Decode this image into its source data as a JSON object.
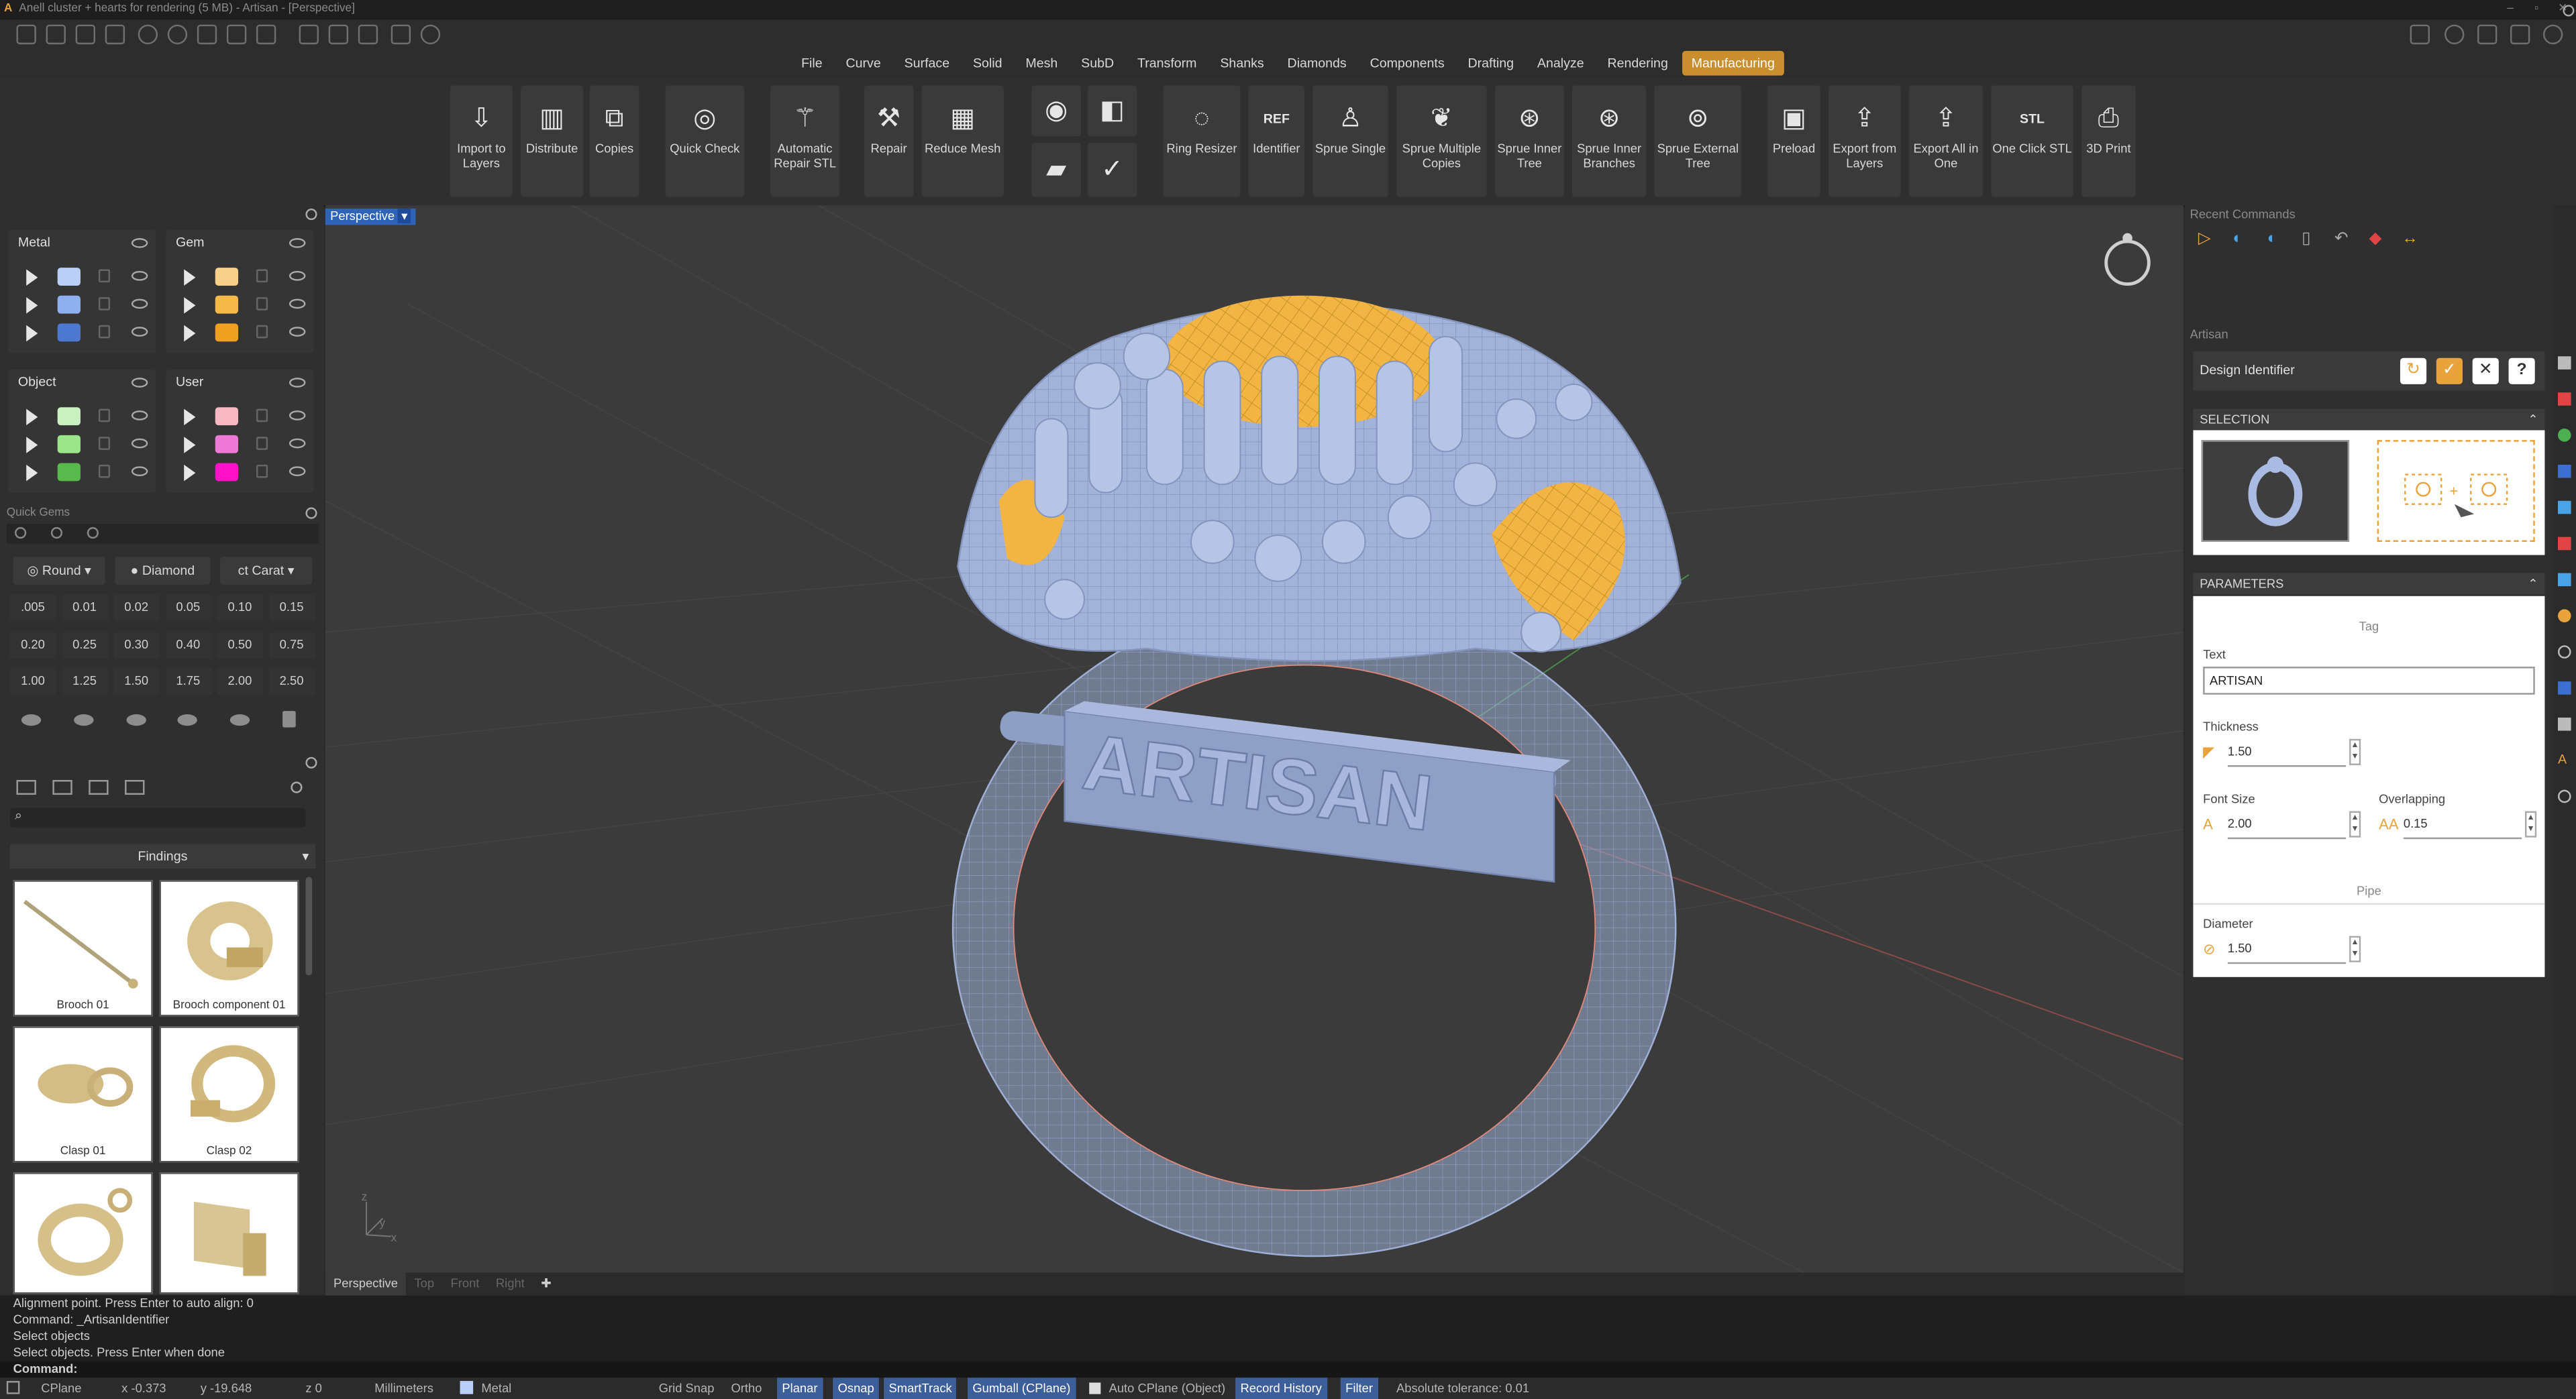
{
  "window": {
    "title": "Anell cluster + hearts for rendering (5 MB) - Artisan - [Perspective]"
  },
  "menu": [
    "File",
    "Curve",
    "Surface",
    "Solid",
    "Mesh",
    "SubD",
    "Transform",
    "Shanks",
    "Diamonds",
    "Components",
    "Drafting",
    "Analyze",
    "Rendering",
    "Manufacturing"
  ],
  "active_menu": "Manufacturing",
  "ribbon": {
    "tools": [
      {
        "label": "Import to Layers",
        "icon": "import-icon"
      },
      {
        "label": "Distribute",
        "icon": "distribute-icon"
      },
      {
        "label": "Copies",
        "icon": "copies-icon"
      },
      {
        "label": "Quick Check",
        "icon": "quick-check-icon"
      },
      {
        "label": "Automatic Repair STL",
        "icon": "magic-wand-icon"
      },
      {
        "label": "Repair",
        "icon": "wrench-icon"
      },
      {
        "label": "Reduce Mesh",
        "icon": "mesh-icon"
      },
      {
        "label": "Ring Resizer",
        "icon": "ring-resizer-icon"
      },
      {
        "label": "Identifier",
        "icon": "ref-icon",
        "badge": "REF"
      },
      {
        "label": "Sprue Single",
        "icon": "sprue-icon"
      },
      {
        "label": "Sprue Multiple Copies",
        "icon": "sprue-tree-icon"
      },
      {
        "label": "Sprue Inner Tree",
        "icon": "sprue-inner-icon"
      },
      {
        "label": "Sprue Inner Branches",
        "icon": "sprue-branches-icon"
      },
      {
        "label": "Sprue External Tree",
        "icon": "sprue-external-icon"
      },
      {
        "label": "Preload",
        "icon": "preload-icon"
      },
      {
        "label": "Export from Layers",
        "icon": "export-layers-icon"
      },
      {
        "label": "Export All in One",
        "icon": "export-all-icon"
      },
      {
        "label": "One Click STL",
        "icon": "stl-icon",
        "badge": "STL"
      },
      {
        "label": "3D Print",
        "icon": "printer-icon"
      }
    ]
  },
  "layers": {
    "groups": [
      {
        "name": "Metal",
        "colors": [
          "#b9cff5",
          "#8fb0ee",
          "#4d78cf"
        ]
      },
      {
        "name": "Gem",
        "colors": [
          "#f8d08a",
          "#f5b849",
          "#f0a020"
        ]
      },
      {
        "name": "Object",
        "colors": [
          "#c9f0c0",
          "#9be68a",
          "#58b94c"
        ]
      },
      {
        "name": "User",
        "colors": [
          "#f7b8c3",
          "#ee78d6",
          "#ff12c8"
        ]
      }
    ]
  },
  "quick_gems": {
    "title": "Quick Gems",
    "shape": "Round",
    "material": "Diamond",
    "unit": "Carat",
    "values": [
      ".005",
      "0.01",
      "0.02",
      "0.05",
      "0.10",
      "0.15",
      "0.20",
      "0.25",
      "0.30",
      "0.40",
      "0.50",
      "0.75",
      "1.00",
      "1.25",
      "1.50",
      "1.75",
      "2.00",
      "2.50"
    ]
  },
  "library": {
    "category": "Findings",
    "items": [
      "Brooch 01",
      "Brooch component 01",
      "Clasp 01",
      "Clasp 02"
    ]
  },
  "viewport": {
    "active": "Perspective",
    "tabs": [
      "Perspective",
      "Top",
      "Front",
      "Right"
    ],
    "engraving": "ARTISAN",
    "axis_labels": [
      "z",
      "y",
      "x"
    ]
  },
  "command_history": [
    "Alignment point. Press Enter to auto align: 0",
    "Command: _ArtisanIdentifier",
    "Select objects",
    "Select objects. Press Enter when done"
  ],
  "command_prompt": "Command:",
  "status": {
    "cplane": "CPlane",
    "x": "x -0.373",
    "y": "y -19.648",
    "z": "z 0",
    "units": "Millimeters",
    "layer": "Metal",
    "grid_snap": "Grid Snap",
    "ortho": "Ortho",
    "planar": "Planar",
    "osnap": "Osnap",
    "smarttrack": "SmartTrack",
    "gumball": "Gumball (CPlane)",
    "auto_cplane": "Auto CPlane (Object)",
    "record_history": "Record History",
    "filter": "Filter",
    "tolerance": "Absolute tolerance: 0.01"
  },
  "right_panel": {
    "recent_title": "Recent Commands",
    "artisan_title": "Artisan",
    "tool_name": "Design Identifier",
    "selection_title": "SELECTION",
    "parameters_title": "PARAMETERS",
    "tag_section": "Tag",
    "text_label": "Text",
    "text_value": "ARTISAN",
    "thickness_label": "Thickness",
    "thickness_value": "1.50",
    "font_size_label": "Font Size",
    "font_size_value": "2.00",
    "overlapping_label": "Overlapping",
    "overlapping_value": "0.15",
    "pipe_section": "Pipe",
    "diameter_label": "Diameter",
    "diameter_value": "1.50"
  }
}
